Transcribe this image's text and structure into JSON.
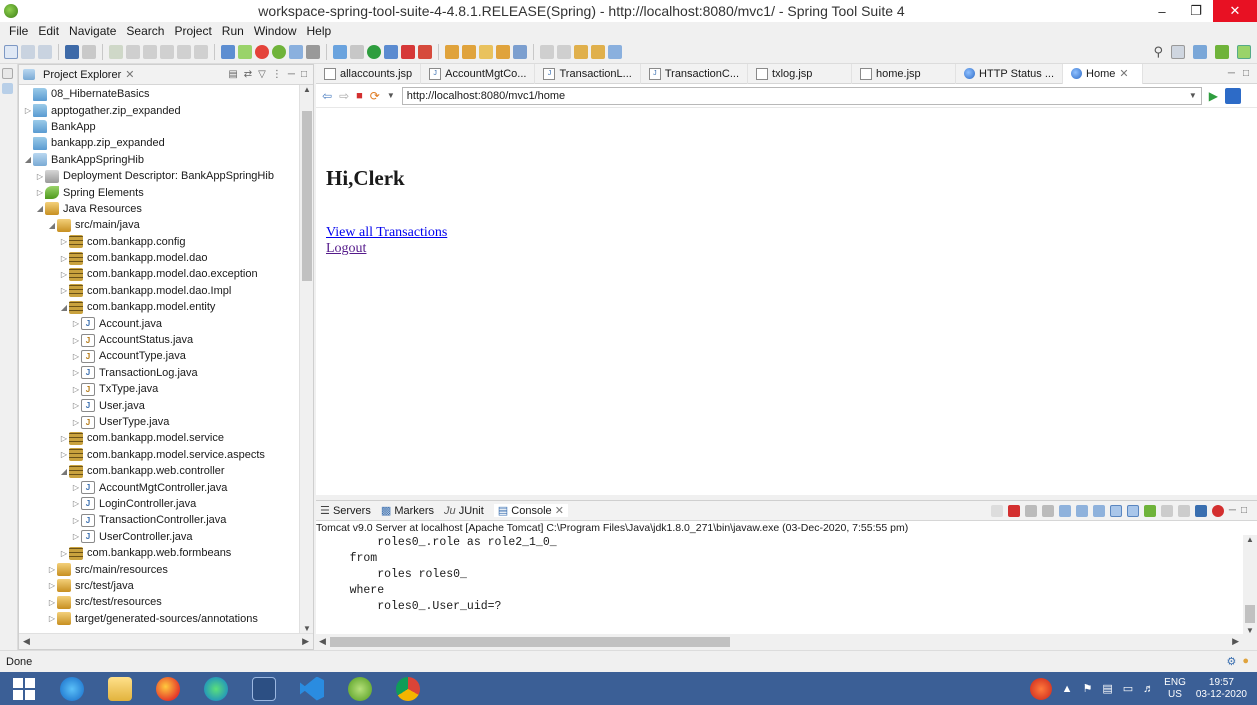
{
  "window": {
    "title": "workspace-spring-tool-suite-4-4.8.1.RELEASE(Spring) - http://localhost:8080/mvc1/ - Spring Tool Suite 4"
  },
  "menu": [
    "File",
    "Edit",
    "Navigate",
    "Search",
    "Project",
    "Run",
    "Window",
    "Help"
  ],
  "explorer": {
    "tab_label": "Project Explorer",
    "tree": [
      {
        "label": "08_HibernateBasics",
        "depth": 0,
        "icon": "folder-icon",
        "arrow": ""
      },
      {
        "label": "apptogather.zip_expanded",
        "depth": 0,
        "icon": "folder-icon",
        "arrow": "▷"
      },
      {
        "label": "BankApp",
        "depth": 0,
        "icon": "folder-icon",
        "arrow": ""
      },
      {
        "label": "bankapp.zip_expanded",
        "depth": 0,
        "icon": "folder-icon",
        "arrow": ""
      },
      {
        "label": "BankAppSpringHib",
        "depth": 0,
        "icon": "project-icon",
        "arrow": "◢"
      },
      {
        "label": "Deployment Descriptor: BankAppSpringHib",
        "depth": 1,
        "icon": "deployment-descriptor-icon",
        "arrow": "▷"
      },
      {
        "label": "Spring Elements",
        "depth": 1,
        "icon": "spring-icon",
        "arrow": "▷"
      },
      {
        "label": "Java Resources",
        "depth": 1,
        "icon": "source-folder-icon",
        "arrow": "◢"
      },
      {
        "label": "src/main/java",
        "depth": 2,
        "icon": "source-folder-icon",
        "arrow": "◢"
      },
      {
        "label": "com.bankapp.config",
        "depth": 3,
        "icon": "package-icon",
        "arrow": "▷"
      },
      {
        "label": "com.bankapp.model.dao",
        "depth": 3,
        "icon": "package-icon",
        "arrow": "▷"
      },
      {
        "label": "com.bankapp.model.dao.exception",
        "depth": 3,
        "icon": "package-icon",
        "arrow": "▷"
      },
      {
        "label": "com.bankapp.model.dao.Impl",
        "depth": 3,
        "icon": "package-icon",
        "arrow": "▷"
      },
      {
        "label": "com.bankapp.model.entity",
        "depth": 3,
        "icon": "package-icon",
        "arrow": "◢"
      },
      {
        "label": "Account.java",
        "depth": 4,
        "icon": "java-file-icon",
        "arrow": "▷"
      },
      {
        "label": "AccountStatus.java",
        "depth": 4,
        "icon": "java-enum-icon",
        "arrow": "▷"
      },
      {
        "label": "AccountType.java",
        "depth": 4,
        "icon": "java-enum-icon",
        "arrow": "▷"
      },
      {
        "label": "TransactionLog.java",
        "depth": 4,
        "icon": "java-file-icon",
        "arrow": "▷"
      },
      {
        "label": "TxType.java",
        "depth": 4,
        "icon": "java-enum-icon",
        "arrow": "▷"
      },
      {
        "label": "User.java",
        "depth": 4,
        "icon": "java-file-icon",
        "arrow": "▷"
      },
      {
        "label": "UserType.java",
        "depth": 4,
        "icon": "java-enum-icon",
        "arrow": "▷"
      },
      {
        "label": "com.bankapp.model.service",
        "depth": 3,
        "icon": "package-icon",
        "arrow": "▷"
      },
      {
        "label": "com.bankapp.model.service.aspects",
        "depth": 3,
        "icon": "package-icon",
        "arrow": "▷"
      },
      {
        "label": "com.bankapp.web.controller",
        "depth": 3,
        "icon": "package-icon",
        "arrow": "◢"
      },
      {
        "label": "AccountMgtController.java",
        "depth": 4,
        "icon": "java-file-icon",
        "arrow": "▷"
      },
      {
        "label": "LoginController.java",
        "depth": 4,
        "icon": "java-file-icon",
        "arrow": "▷"
      },
      {
        "label": "TransactionController.java",
        "depth": 4,
        "icon": "java-file-icon",
        "arrow": "▷"
      },
      {
        "label": "UserController.java",
        "depth": 4,
        "icon": "java-file-icon",
        "arrow": "▷"
      },
      {
        "label": "com.bankapp.web.formbeans",
        "depth": 3,
        "icon": "package-icon",
        "arrow": "▷"
      },
      {
        "label": "src/main/resources",
        "depth": 2,
        "icon": "source-folder-icon",
        "arrow": "▷"
      },
      {
        "label": "src/test/java",
        "depth": 2,
        "icon": "source-folder-icon",
        "arrow": "▷"
      },
      {
        "label": "src/test/resources",
        "depth": 2,
        "icon": "source-folder-icon",
        "arrow": "▷"
      },
      {
        "label": "target/generated-sources/annotations",
        "depth": 2,
        "icon": "source-folder-icon",
        "arrow": "▷"
      }
    ]
  },
  "editor_tabs": [
    {
      "label": "allaccounts.jsp",
      "icon": "jsp-file-icon"
    },
    {
      "label": "AccountMgtCo...",
      "icon": "java-file-icon"
    },
    {
      "label": "TransactionL...",
      "icon": "java-file-icon"
    },
    {
      "label": "TransactionC...",
      "icon": "java-file-icon"
    },
    {
      "label": "txlog.jsp",
      "icon": "jsp-file-icon"
    },
    {
      "label": "home.jsp",
      "icon": "jsp-file-icon"
    },
    {
      "label": "HTTP Status ...",
      "icon": "globe-icon"
    },
    {
      "label": "Home",
      "icon": "globe-icon",
      "active": true
    }
  ],
  "browser": {
    "url": "http://localhost:8080/mvc1/home",
    "heading": "Hi,Clerk",
    "links": [
      "View all Transactions",
      "Logout"
    ]
  },
  "console": {
    "tabs": [
      "Servers",
      "Markers",
      "JUnit",
      "Console"
    ],
    "info": "Tomcat v9.0 Server at localhost [Apache Tomcat] C:\\Program Files\\Java\\jdk1.8.0_271\\bin\\javaw.exe  (03-Dec-2020, 7:55:55 pm)",
    "lines": [
      "        roles0_.role as role2_1_0_",
      "    from",
      "        roles roles0_",
      "    where",
      "        roles0_.User_uid=?"
    ]
  },
  "status": {
    "text": "Done"
  },
  "taskbar": {
    "lang_top": "ENG",
    "lang_bottom": "US",
    "time": "19:57",
    "date": "03-12-2020"
  },
  "colors": {
    "taskbar": "#3b5f96",
    "close": "#e81123",
    "link": "#0000ee",
    "visited": "#551a8b"
  }
}
